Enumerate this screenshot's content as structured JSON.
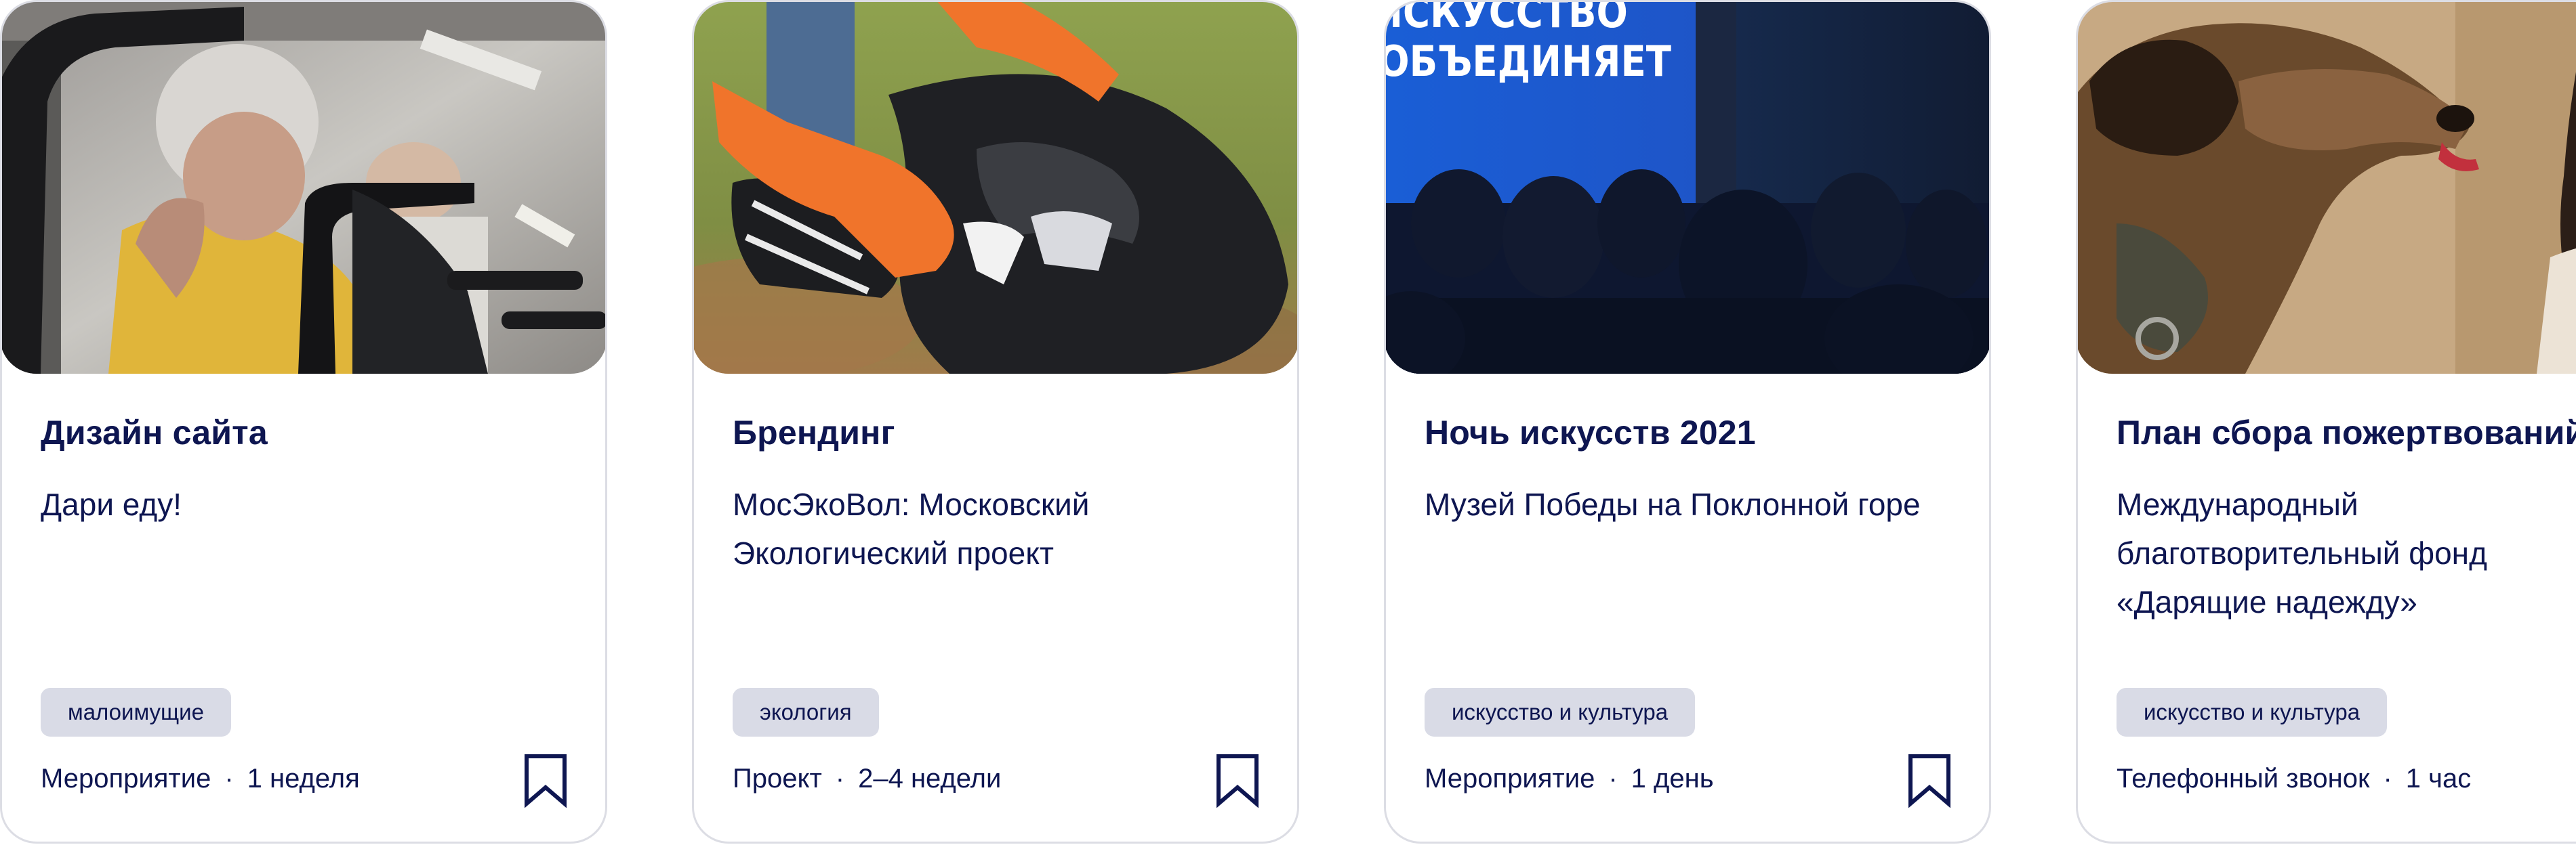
{
  "cards": [
    {
      "title": "Дизайн сайта",
      "subtitle": "Дари еду!",
      "tag": "малоимущие",
      "format": "Мероприятие",
      "separator": "·",
      "duration": "1 неделя",
      "bookmark_icon": "bookmark-icon",
      "photo": "elderly-person-in-wheelchair"
    },
    {
      "title": "Брендинг",
      "subtitle": "МосЭкоВол: Московский Экологический проект",
      "tag": "экология",
      "format": "Проект",
      "separator": "·",
      "duration": "2–4 недели",
      "bookmark_icon": "bookmark-icon",
      "photo": "hands-in-gloves-with-trash-bag"
    },
    {
      "title": "Ночь искусств 2021",
      "subtitle": "Музей Победы на Поклонной горе",
      "tag": "искусство и культура",
      "format": "Мероприятие",
      "separator": "·",
      "duration": "1 день",
      "bookmark_icon": "bookmark-icon",
      "photo": "audience-in-front-of-screen",
      "photo_text": [
        "ИСКУССТВО",
        "ОБЪЕДИНЯЕТ"
      ]
    },
    {
      "title": "План сбора пожертвований",
      "subtitle": "Международный благотворительный фонд «Дарящие надежду»",
      "tag": "искусство и культура",
      "format": "Телефонный звонок",
      "separator": "·",
      "duration": "1 час",
      "photo": "dog-and-woman"
    }
  ],
  "colors": {
    "text": "#0e1651",
    "tag_bg": "#d9dbe6",
    "card_border": "#dcdde4"
  }
}
